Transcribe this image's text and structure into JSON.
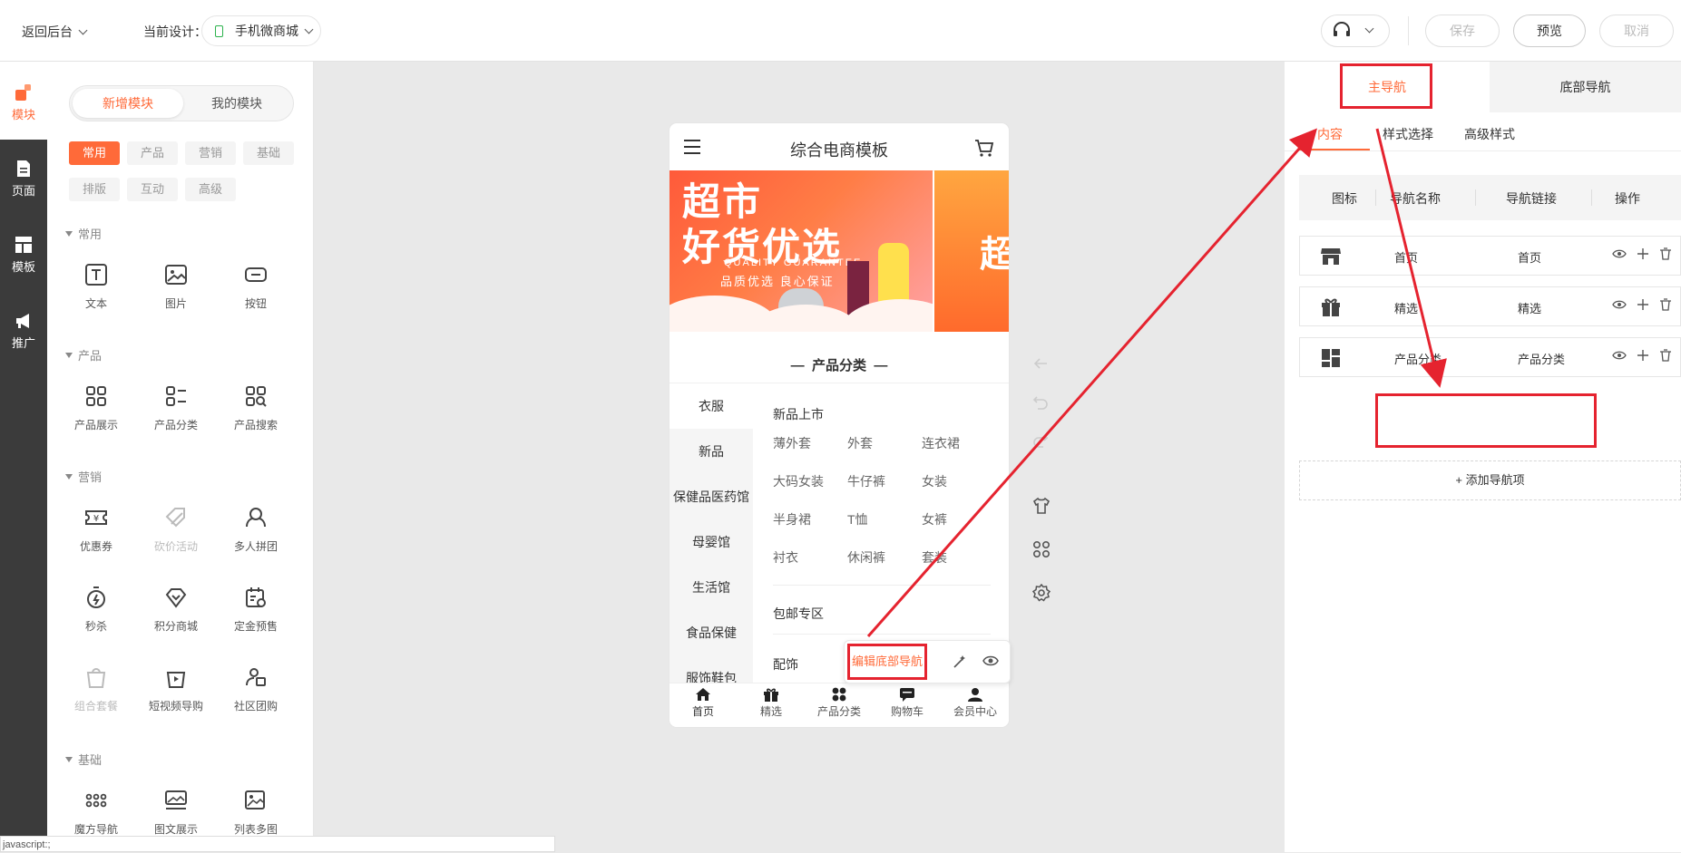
{
  "topbar": {
    "back_label": "返回后台",
    "current_design_label": "当前设计：",
    "design_name": "手机微商城",
    "save": "保存",
    "preview": "预览",
    "cancel": "取消"
  },
  "rail": {
    "items": [
      {
        "label": "模块",
        "icon": "module-icon"
      },
      {
        "label": "页面",
        "icon": "page-icon"
      },
      {
        "label": "模板",
        "icon": "template-icon"
      },
      {
        "label": "推广",
        "icon": "promote-icon"
      }
    ]
  },
  "left_panel": {
    "seg_new": "新增模块",
    "seg_mine": "我的模块",
    "chips": [
      "常用",
      "产品",
      "营销",
      "基础",
      "排版",
      "互动",
      "高级"
    ],
    "sections": [
      {
        "title": "常用",
        "modules": [
          "文本",
          "图片",
          "按钮"
        ]
      },
      {
        "title": "产品",
        "modules": [
          "产品展示",
          "产品分类",
          "产品搜索"
        ]
      },
      {
        "title": "营销",
        "modules": [
          "优惠券",
          "砍价活动",
          "多人拼团",
          "秒杀",
          "积分商城",
          "定金预售",
          "组合套餐",
          "短视频导购",
          "社区团购"
        ]
      },
      {
        "title": "基础",
        "modules": [
          "魔方导航",
          "图文展示",
          "列表多图"
        ]
      }
    ]
  },
  "status_bar": "javascript:;",
  "phone": {
    "title": "综合电商模板",
    "banner_main": "超市",
    "banner_main2": "好货优选",
    "banner_en": "QUALITY GUARANTEE",
    "banner_cn": "品质优选 良心保证",
    "banner2_text": "超",
    "category_title": "产品分类",
    "left_categories": [
      "衣服",
      "新品",
      "保健品医药馆",
      "母婴馆",
      "生活馆",
      "食品保健",
      "服饰鞋包"
    ],
    "right_group1_title": "新品上市",
    "right_group1_items": [
      "薄外套",
      "外套",
      "连衣裙",
      "大码女装",
      "牛仔裤",
      "女装",
      "半身裙",
      "T恤",
      "女裤",
      "衬衣",
      "休闲裤",
      "套装"
    ],
    "right_group2_title": "包邮专区",
    "right_group3_title": "配饰",
    "edit_bottom_nav": "编辑底部导航",
    "tabs": [
      "首页",
      "精选",
      "产品分类",
      "购物车",
      "会员中心"
    ]
  },
  "right_panel": {
    "tab_main": "主导航",
    "tab_bottom": "底部导航",
    "sub_tabs": [
      "内容",
      "样式选择",
      "高级样式"
    ],
    "table_headers": [
      "图标",
      "导航名称",
      "导航链接",
      "操作"
    ],
    "rows": [
      {
        "name": "首页",
        "link": "首页",
        "icon": "store-icon"
      },
      {
        "name": "精选",
        "link": "精选",
        "icon": "gift-icon"
      },
      {
        "name": "产品分类",
        "link": "产品分类",
        "icon": "grid-icon"
      }
    ],
    "add_nav": "+ 添加导航项"
  },
  "colors": {
    "accent": "#ff6a39",
    "annotation": "#e5232f"
  }
}
